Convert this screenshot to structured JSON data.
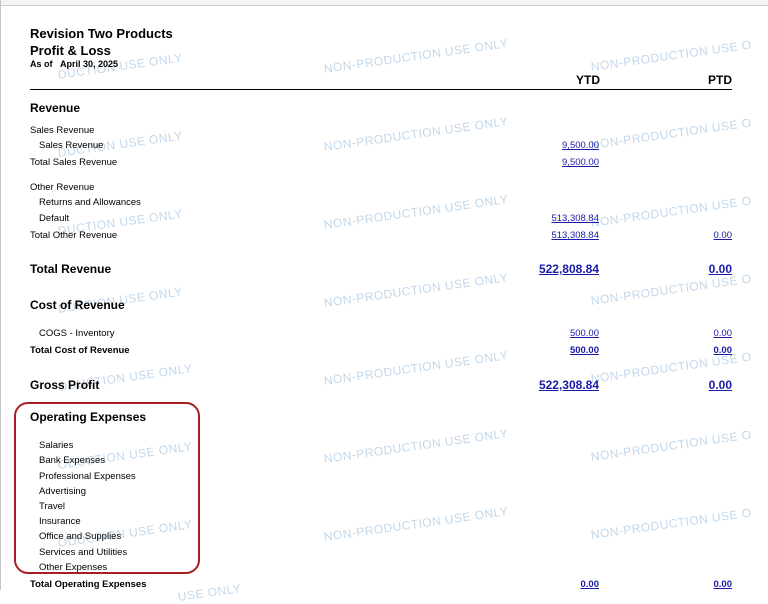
{
  "header": {
    "company": "Revision Two Products",
    "report_title": "Profit & Loss",
    "as_of_label": "As of",
    "as_of_date": "April 30, 2025"
  },
  "columns": {
    "ytd": "YTD",
    "ptd": "PTD"
  },
  "watermark": {
    "text": "NON-PRODUCTION USE ONLY",
    "text_cut": "NON-PRODUCTION USE O",
    "text_tail_1": "DUCTION USE ONLY",
    "text_tail_2": "ODUCTION USE ONLY",
    "text_tail_3": "USE ONLY",
    "color": "#6ea0cd"
  },
  "revenue": {
    "section": "Revenue",
    "sales_group": "Sales Revenue",
    "sales_item": "Sales Revenue",
    "sales_item_ytd": "9,500.00",
    "sales_total_label": "Total Sales Revenue",
    "sales_total_ytd": "9,500.00",
    "other_group": "Other Revenue",
    "returns_item": "Returns and Allowances",
    "default_item": "Default",
    "default_item_ytd": "513,308.84",
    "other_total_label": "Total Other Revenue",
    "other_total_ytd": "513,308.84",
    "other_total_ptd": "0.00",
    "total_label": "Total Revenue",
    "total_ytd": "522,808.84",
    "total_ptd": "0.00"
  },
  "cost_of_revenue": {
    "section": "Cost of Revenue",
    "cogs_item": "COGS - Inventory",
    "cogs_ytd": "500.00",
    "cogs_ptd": "0.00",
    "total_label": "Total Cost of Revenue",
    "total_ytd": "500.00",
    "total_ptd": "0.00"
  },
  "gross_profit": {
    "label": "Gross Profit",
    "ytd": "522,308.84",
    "ptd": "0.00"
  },
  "operating_expenses": {
    "section": "Operating Expenses",
    "items": [
      "Salaries",
      "Bank Expenses",
      "Professional Expenses",
      "Advertising",
      "Travel",
      "Insurance",
      "Office and Supplies",
      "Services and Utilities",
      "Other Expenses"
    ],
    "total_label": "Total Operating Expenses",
    "total_ytd": "0.00",
    "total_ptd": "0.00"
  },
  "highlight_color": "#a81e22"
}
